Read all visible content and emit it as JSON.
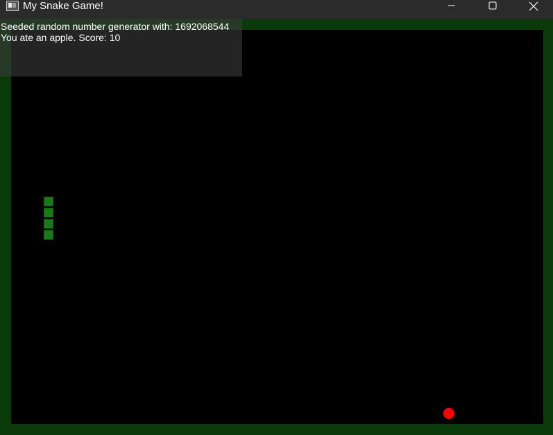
{
  "window": {
    "title": "My Snake Game!",
    "icon": "app-window-icon",
    "controls": {
      "minimize": "minimize-icon",
      "maximize": "maximize-icon",
      "close": "close-icon"
    }
  },
  "console": {
    "lines": [
      "Seeded random number generator with: 1692068544",
      "You ate an apple. Score: 10"
    ]
  },
  "game": {
    "score": 10,
    "snake_segments": 4,
    "colors": {
      "border": "#0a3a0a",
      "playfield": "#000000",
      "snake": "#1a7a1a",
      "apple": "#ff0000"
    }
  }
}
